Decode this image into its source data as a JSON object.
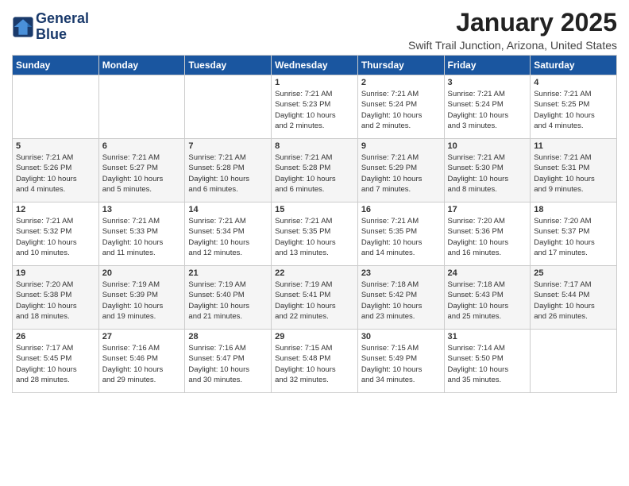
{
  "logo": {
    "line1": "General",
    "line2": "Blue"
  },
  "title": "January 2025",
  "subtitle": "Swift Trail Junction, Arizona, United States",
  "weekdays": [
    "Sunday",
    "Monday",
    "Tuesday",
    "Wednesday",
    "Thursday",
    "Friday",
    "Saturday"
  ],
  "weeks": [
    [
      {
        "day": "",
        "info": ""
      },
      {
        "day": "",
        "info": ""
      },
      {
        "day": "",
        "info": ""
      },
      {
        "day": "1",
        "info": "Sunrise: 7:21 AM\nSunset: 5:23 PM\nDaylight: 10 hours\nand 2 minutes."
      },
      {
        "day": "2",
        "info": "Sunrise: 7:21 AM\nSunset: 5:24 PM\nDaylight: 10 hours\nand 2 minutes."
      },
      {
        "day": "3",
        "info": "Sunrise: 7:21 AM\nSunset: 5:24 PM\nDaylight: 10 hours\nand 3 minutes."
      },
      {
        "day": "4",
        "info": "Sunrise: 7:21 AM\nSunset: 5:25 PM\nDaylight: 10 hours\nand 4 minutes."
      }
    ],
    [
      {
        "day": "5",
        "info": "Sunrise: 7:21 AM\nSunset: 5:26 PM\nDaylight: 10 hours\nand 4 minutes."
      },
      {
        "day": "6",
        "info": "Sunrise: 7:21 AM\nSunset: 5:27 PM\nDaylight: 10 hours\nand 5 minutes."
      },
      {
        "day": "7",
        "info": "Sunrise: 7:21 AM\nSunset: 5:28 PM\nDaylight: 10 hours\nand 6 minutes."
      },
      {
        "day": "8",
        "info": "Sunrise: 7:21 AM\nSunset: 5:28 PM\nDaylight: 10 hours\nand 6 minutes."
      },
      {
        "day": "9",
        "info": "Sunrise: 7:21 AM\nSunset: 5:29 PM\nDaylight: 10 hours\nand 7 minutes."
      },
      {
        "day": "10",
        "info": "Sunrise: 7:21 AM\nSunset: 5:30 PM\nDaylight: 10 hours\nand 8 minutes."
      },
      {
        "day": "11",
        "info": "Sunrise: 7:21 AM\nSunset: 5:31 PM\nDaylight: 10 hours\nand 9 minutes."
      }
    ],
    [
      {
        "day": "12",
        "info": "Sunrise: 7:21 AM\nSunset: 5:32 PM\nDaylight: 10 hours\nand 10 minutes."
      },
      {
        "day": "13",
        "info": "Sunrise: 7:21 AM\nSunset: 5:33 PM\nDaylight: 10 hours\nand 11 minutes."
      },
      {
        "day": "14",
        "info": "Sunrise: 7:21 AM\nSunset: 5:34 PM\nDaylight: 10 hours\nand 12 minutes."
      },
      {
        "day": "15",
        "info": "Sunrise: 7:21 AM\nSunset: 5:35 PM\nDaylight: 10 hours\nand 13 minutes."
      },
      {
        "day": "16",
        "info": "Sunrise: 7:21 AM\nSunset: 5:35 PM\nDaylight: 10 hours\nand 14 minutes."
      },
      {
        "day": "17",
        "info": "Sunrise: 7:20 AM\nSunset: 5:36 PM\nDaylight: 10 hours\nand 16 minutes."
      },
      {
        "day": "18",
        "info": "Sunrise: 7:20 AM\nSunset: 5:37 PM\nDaylight: 10 hours\nand 17 minutes."
      }
    ],
    [
      {
        "day": "19",
        "info": "Sunrise: 7:20 AM\nSunset: 5:38 PM\nDaylight: 10 hours\nand 18 minutes."
      },
      {
        "day": "20",
        "info": "Sunrise: 7:19 AM\nSunset: 5:39 PM\nDaylight: 10 hours\nand 19 minutes."
      },
      {
        "day": "21",
        "info": "Sunrise: 7:19 AM\nSunset: 5:40 PM\nDaylight: 10 hours\nand 21 minutes."
      },
      {
        "day": "22",
        "info": "Sunrise: 7:19 AM\nSunset: 5:41 PM\nDaylight: 10 hours\nand 22 minutes."
      },
      {
        "day": "23",
        "info": "Sunrise: 7:18 AM\nSunset: 5:42 PM\nDaylight: 10 hours\nand 23 minutes."
      },
      {
        "day": "24",
        "info": "Sunrise: 7:18 AM\nSunset: 5:43 PM\nDaylight: 10 hours\nand 25 minutes."
      },
      {
        "day": "25",
        "info": "Sunrise: 7:17 AM\nSunset: 5:44 PM\nDaylight: 10 hours\nand 26 minutes."
      }
    ],
    [
      {
        "day": "26",
        "info": "Sunrise: 7:17 AM\nSunset: 5:45 PM\nDaylight: 10 hours\nand 28 minutes."
      },
      {
        "day": "27",
        "info": "Sunrise: 7:16 AM\nSunset: 5:46 PM\nDaylight: 10 hours\nand 29 minutes."
      },
      {
        "day": "28",
        "info": "Sunrise: 7:16 AM\nSunset: 5:47 PM\nDaylight: 10 hours\nand 30 minutes."
      },
      {
        "day": "29",
        "info": "Sunrise: 7:15 AM\nSunset: 5:48 PM\nDaylight: 10 hours\nand 32 minutes."
      },
      {
        "day": "30",
        "info": "Sunrise: 7:15 AM\nSunset: 5:49 PM\nDaylight: 10 hours\nand 34 minutes."
      },
      {
        "day": "31",
        "info": "Sunrise: 7:14 AM\nSunset: 5:50 PM\nDaylight: 10 hours\nand 35 minutes."
      },
      {
        "day": "",
        "info": ""
      }
    ]
  ]
}
